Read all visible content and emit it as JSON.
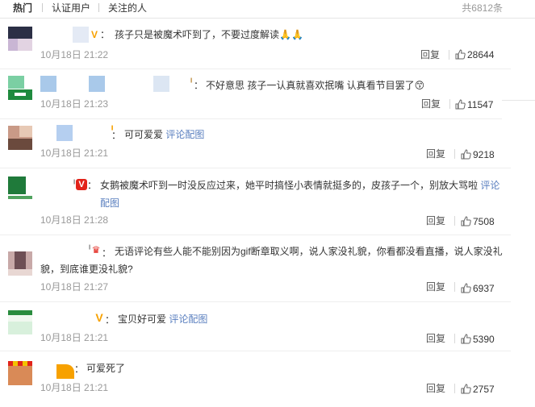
{
  "tabs": [
    {
      "label": "热门"
    },
    {
      "label": "认证用户"
    },
    {
      "label": "关注的人"
    }
  ],
  "total_label": "共6812条",
  "colors": {
    "link": "#5a7fbf",
    "muted": "#999999",
    "text": "#333333",
    "badge_orange": "#f7a100",
    "badge_red": "#e2231a"
  },
  "comments": [
    {
      "text": "孩子只是被魔术吓到了，不要过度解读",
      "emoji": "🙏🙏",
      "time": "10月18日 21:22",
      "reply": "回复",
      "likes": "28644",
      "badge": "orange-v-badge-icon"
    },
    {
      "text": "不好意思 孩子一认真就喜欢抿嘴 认真看节目罢了",
      "emoji": "😙",
      "time": "10月18日 21:23",
      "reply": "回复",
      "likes": "11547",
      "badge": "member-badge-icon"
    },
    {
      "text": "可可爱爱 ",
      "link": "评论配图",
      "time": "10月18日 21:21",
      "reply": "回复",
      "likes": "9218",
      "badge": "member-badge-icon"
    },
    {
      "text": "女鹅被魔术吓到一时没反应过来，她平时搞怪小表情就挺多的，皮孩子一个，别放大骂啦 ",
      "link": "评论配图",
      "time": "10月18日 21:28",
      "reply": "回复",
      "likes": "7508",
      "badge": "red-v-badge-icon"
    },
    {
      "text": "无语评论有些人能不能别因为gif断章取义啊，说人家没礼貌，你看都没看直播，说人家没礼貌，到底谁更没礼貌?",
      "time": "10月18日 21:27",
      "reply": "回复",
      "likes": "6937",
      "badge": "crown-badge-icon"
    },
    {
      "text": "宝贝好可爱 ",
      "link": "评论配图",
      "time": "10月18日 21:21",
      "reply": "回复",
      "likes": "5390",
      "badge": "orange-v-badge-icon"
    },
    {
      "text": "可爱死了",
      "time": "10月18日 21:21",
      "reply": "回复",
      "likes": "2757",
      "badge": "orange-v-badge-icon"
    }
  ]
}
